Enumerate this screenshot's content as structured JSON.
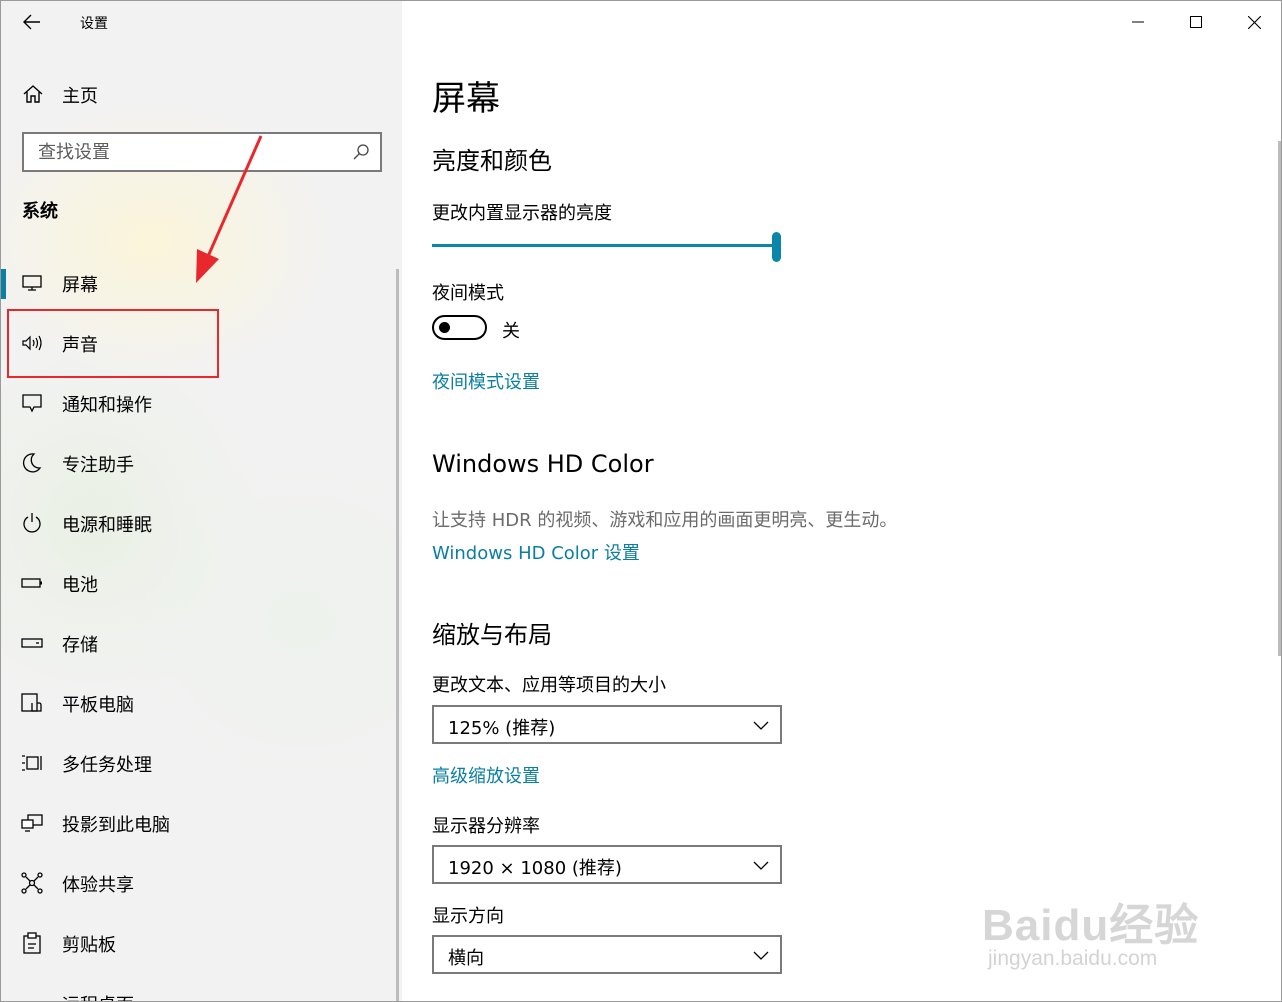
{
  "app": {
    "title": "设置"
  },
  "sidebar": {
    "home_label": "主页",
    "search_placeholder": "查找设置",
    "section_title": "系统",
    "items": [
      {
        "label": "屏幕",
        "icon": "monitor-icon",
        "selected": true
      },
      {
        "label": "声音",
        "icon": "speaker-icon"
      },
      {
        "label": "通知和操作",
        "icon": "notification-icon"
      },
      {
        "label": "专注助手",
        "icon": "moon-icon"
      },
      {
        "label": "电源和睡眠",
        "icon": "power-icon"
      },
      {
        "label": "电池",
        "icon": "battery-icon"
      },
      {
        "label": "存储",
        "icon": "storage-icon"
      },
      {
        "label": "平板电脑",
        "icon": "tablet-icon"
      },
      {
        "label": "多任务处理",
        "icon": "multitask-icon"
      },
      {
        "label": "投影到此电脑",
        "icon": "project-icon"
      },
      {
        "label": "体验共享",
        "icon": "share-icon"
      },
      {
        "label": "剪贴板",
        "icon": "clipboard-icon"
      },
      {
        "label": "远程桌面",
        "icon": "remote-desktop-icon"
      }
    ]
  },
  "main": {
    "page_title": "屏幕",
    "brightness_section": "亮度和颜色",
    "brightness_label": "更改内置显示器的亮度",
    "brightness_value": 1.0,
    "night_mode_label": "夜间模式",
    "night_mode_state": "关",
    "night_mode_settings_link": "夜间模式设置",
    "hdr_section": "Windows HD Color",
    "hdr_desc": "让支持 HDR 的视频、游戏和应用的画面更明亮、更生动。",
    "hdr_link": "Windows HD Color 设置",
    "scale_section": "缩放与布局",
    "scale_label": "更改文本、应用等项目的大小",
    "scale_value": "125% (推荐)",
    "advanced_scale_link": "高级缩放设置",
    "resolution_label": "显示器分辨率",
    "resolution_value": "1920 × 1080 (推荐)",
    "orientation_label": "显示方向",
    "orientation_value": "横向"
  },
  "watermark": {
    "line1": "Baidu经验",
    "line2": "jingyan.baidu.com"
  },
  "colors": {
    "accent": "#0b7fa3",
    "annotation": "#e8282d"
  }
}
